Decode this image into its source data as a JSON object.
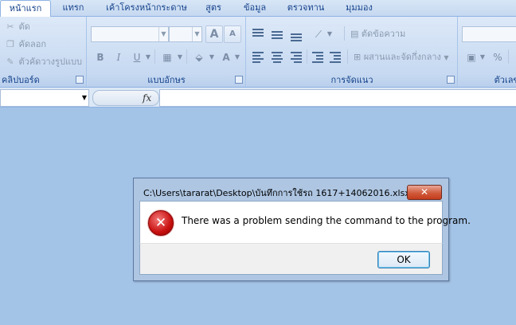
{
  "tabs": [
    {
      "label": "หน้าแรก",
      "active": true
    },
    {
      "label": "แทรก"
    },
    {
      "label": "เค้าโครงหน้ากระดาษ"
    },
    {
      "label": "สูตร"
    },
    {
      "label": "ข้อมูล"
    },
    {
      "label": "ตรวจทาน"
    },
    {
      "label": "มุมมอง"
    }
  ],
  "clipboard": {
    "cut": "ตัด",
    "copy": "คัดลอก",
    "format_painter": "ตัวคัดวางรูปแบบ",
    "group_label": "คลิปบอร์ด"
  },
  "font": {
    "group_label": "แบบอักษร",
    "grow": "A",
    "shrink": "A",
    "bold": "B",
    "italic": "I",
    "underline": "U",
    "font_color": "A"
  },
  "alignment": {
    "wrap_text": "ตัดข้อความ",
    "merge_center": "ผสานและจัดกึ่งกลาง",
    "group_label": "การจัดแนว"
  },
  "number": {
    "group_label": "ตัวเลข",
    "percent": "%"
  },
  "formula_bar": {
    "fx": "fx",
    "value": ""
  },
  "dialog": {
    "title": "C:\\Users\\tararat\\Desktop\\บันทึกการใช้รถ 1617+14062016.xlsx",
    "close": "✕",
    "message": "There was a problem sending the command to the program.",
    "ok": "OK"
  },
  "colors": {
    "workspace": "#a3c3e7",
    "ribbon": "#c9dbf2",
    "error_red": "#c81010"
  }
}
